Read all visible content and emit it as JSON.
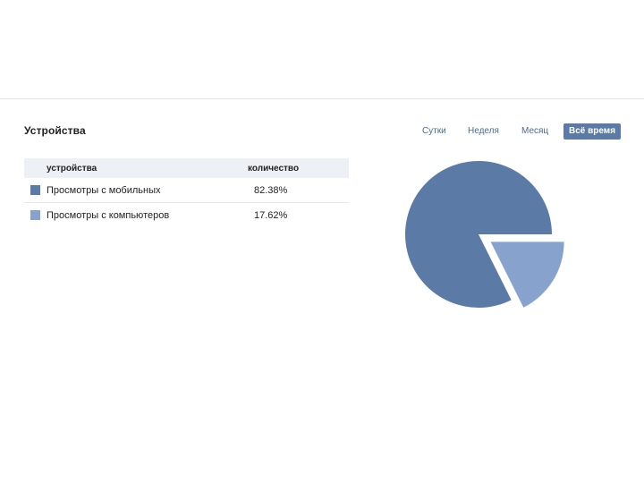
{
  "section": {
    "title": "Устройства"
  },
  "period_tabs": [
    {
      "label": "Сутки",
      "active": false
    },
    {
      "label": "Неделя",
      "active": false
    },
    {
      "label": "Месяц",
      "active": false
    },
    {
      "label": "Всё время",
      "active": true
    }
  ],
  "table": {
    "headers": {
      "name": "устройства",
      "count": "количество"
    },
    "rows": [
      {
        "label": "Просмотры с мобильных",
        "value": "82.38%",
        "color": "#5b7ba6"
      },
      {
        "label": "Просмотры с компьютеров",
        "value": "17.62%",
        "color": "#87a2cc"
      }
    ]
  },
  "chart_data": {
    "type": "pie",
    "categories": [
      "Просмотры с мобильных",
      "Просмотры с компьютеров"
    ],
    "values": [
      82.38,
      17.62
    ],
    "colors": [
      "#5b7ba6",
      "#87a2cc"
    ],
    "exploded": [
      false,
      true
    ],
    "title": "",
    "legend": "table-left"
  }
}
